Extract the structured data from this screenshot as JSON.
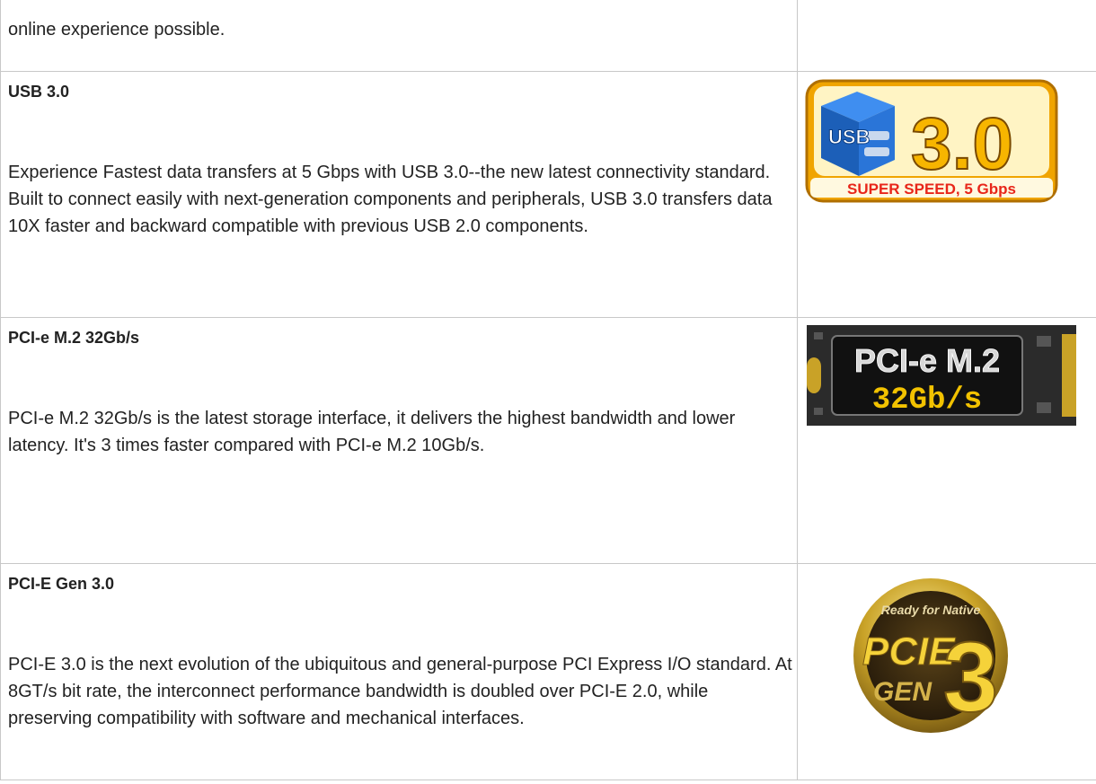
{
  "intro": {
    "tail_text": "online experience possible."
  },
  "features": [
    {
      "title": "USB 3.0",
      "description": "Experience Fastest data transfers at 5 Gbps with USB 3.0--the new latest connectivity standard. Built to connect easily with next-generation components and peripherals, USB 3.0 transfers data 10X faster and backward compatible with previous USB 2.0 components.",
      "logo": {
        "icon": "usb-3-logo",
        "text_usb": "USB",
        "text_version": "3.0",
        "text_banner": "SUPER SPEED, 5 Gbps",
        "colors": {
          "frame": "#f0a400",
          "banner": "#e8261a",
          "cube": "#1f6fd1"
        }
      }
    },
    {
      "title": "PCI-e M.2 32Gb/s",
      "description": "PCI-e M.2 32Gb/s is the latest storage interface, it delivers the highest bandwidth and lower latency. It's 3 times faster compared with PCI-e M.2 10Gb/s.",
      "logo": {
        "icon": "pcie-m2-card-logo",
        "text_line1": "PCI-e M.2",
        "text_line2": "32Gb/s",
        "colors": {
          "board": "#2b2b2b",
          "label": "#f2c200",
          "gold": "#c9a227"
        }
      }
    },
    {
      "title": "PCI-E Gen 3.0",
      "description": "PCI-E 3.0 is the next evolution of the ubiquitous and general-purpose PCI Express I/O standard. At 8GT/s bit rate, the interconnect performance bandwidth is doubled over PCI-E 2.0, while preserving compatibility with software and mechanical interfaces.",
      "logo": {
        "icon": "pcie-gen3-badge",
        "text_top": "Ready for Native",
        "text_main": "PCIE",
        "text_gen": "GEN",
        "text_num": "3",
        "colors": {
          "ring": "#c9a227",
          "inner": "#3a2a10",
          "text": "#f5d23a"
        }
      }
    }
  ]
}
